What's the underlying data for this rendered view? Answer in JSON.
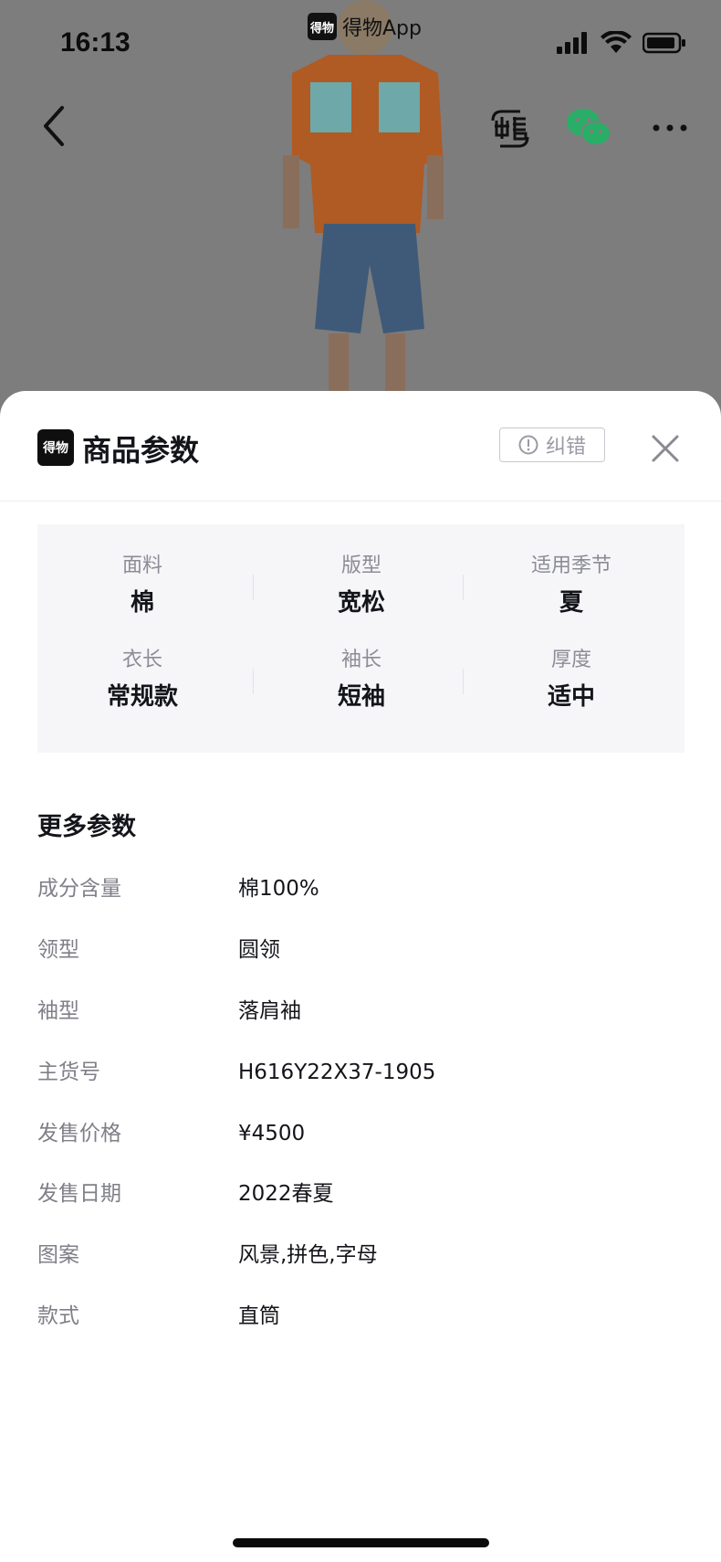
{
  "status_bar": {
    "time": "16:13",
    "app_badge": "得物",
    "app_label": "得物App"
  },
  "nav": {
    "back_icon": "chevron-left-icon",
    "sell_icon": "sell-icon",
    "share_icon": "wechat-icon",
    "more_icon": "more-icon"
  },
  "sheet": {
    "brand_badge": "得物",
    "title": "商品参数",
    "report_label": "纠错",
    "report_icon": "alert-circle-icon",
    "close_icon": "close-icon"
  },
  "key_params": [
    {
      "label": "面料",
      "value": "棉"
    },
    {
      "label": "版型",
      "value": "宽松"
    },
    {
      "label": "适用季节",
      "value": "夏"
    },
    {
      "label": "衣长",
      "value": "常规款"
    },
    {
      "label": "袖长",
      "value": "短袖"
    },
    {
      "label": "厚度",
      "value": "适中"
    }
  ],
  "more_params": {
    "title": "更多参数",
    "rows": [
      {
        "label": "成分含量",
        "value": "棉100%"
      },
      {
        "label": "领型",
        "value": "圆领"
      },
      {
        "label": "袖型",
        "value": "落肩袖"
      },
      {
        "label": "主货号",
        "value": "H616Y22X37-1905"
      },
      {
        "label": "发售价格",
        "value": "¥4500"
      },
      {
        "label": "发售日期",
        "value": "2022春夏"
      },
      {
        "label": "图案",
        "value": "风景,拼色,字母"
      },
      {
        "label": "款式",
        "value": "直筒"
      }
    ]
  },
  "colors": {
    "accent_wechat": "#2aae67",
    "dim_bg": "#7d7d7d",
    "panel_bg": "#f6f6f9"
  }
}
